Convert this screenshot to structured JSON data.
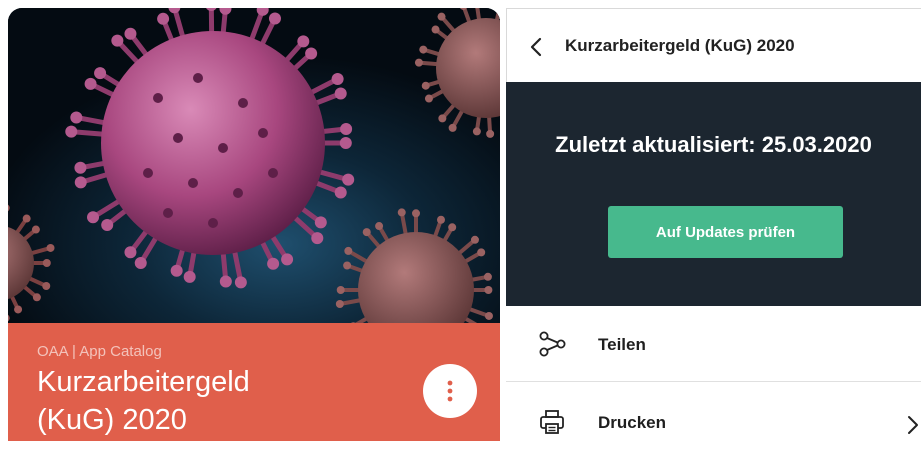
{
  "card": {
    "publisher": "OAA | App Catalog",
    "title_line1": "Kurzarbeitergeld",
    "title_line2": "(KuG) 2020",
    "image_subject": "virus-image",
    "footer_color": "#e05f4b",
    "more_icon": "more-vertical-icon"
  },
  "panel": {
    "header": {
      "title": "Kurzarbeitergeld (KuG) 2020",
      "back_icon": "chevron-left-icon"
    },
    "update": {
      "last_updated": "Zuletzt aktualisiert: 25.03.2020",
      "check_button": "Auf Updates prüfen",
      "background_color": "#1c2630",
      "button_color": "#47b98d"
    },
    "menu": [
      {
        "label": "Teilen",
        "icon": "share-icon"
      },
      {
        "label": "Drucken",
        "icon": "printer-icon"
      }
    ]
  }
}
